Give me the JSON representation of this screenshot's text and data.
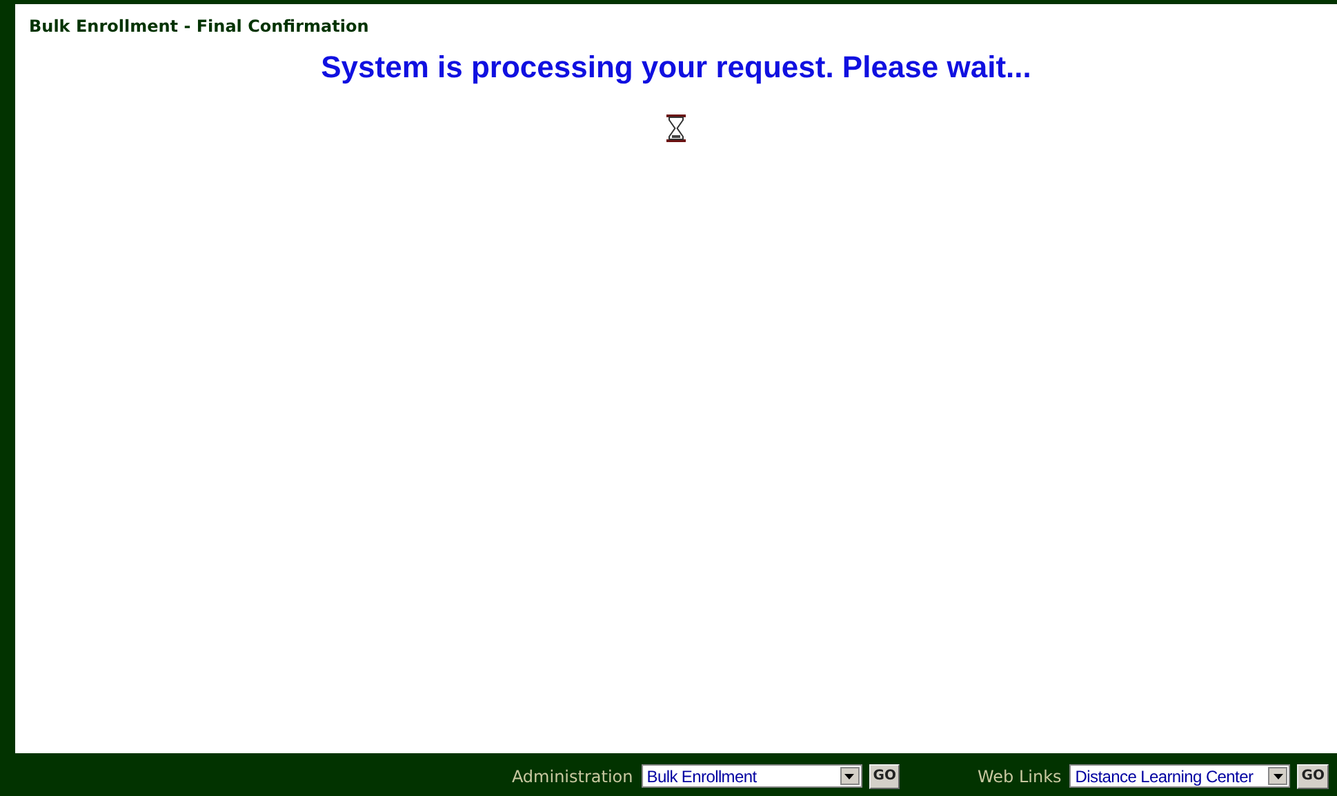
{
  "page_title": "Bulk Enrollment - Final Confirmation",
  "message": "System is processing your request. Please wait...",
  "footer": {
    "menus": [
      {
        "label": "Administration",
        "value": "Bulk Enrollment",
        "button": "GO"
      },
      {
        "label": "Web Links",
        "value": "Distance Learning Center",
        "button": "GO"
      }
    ]
  }
}
